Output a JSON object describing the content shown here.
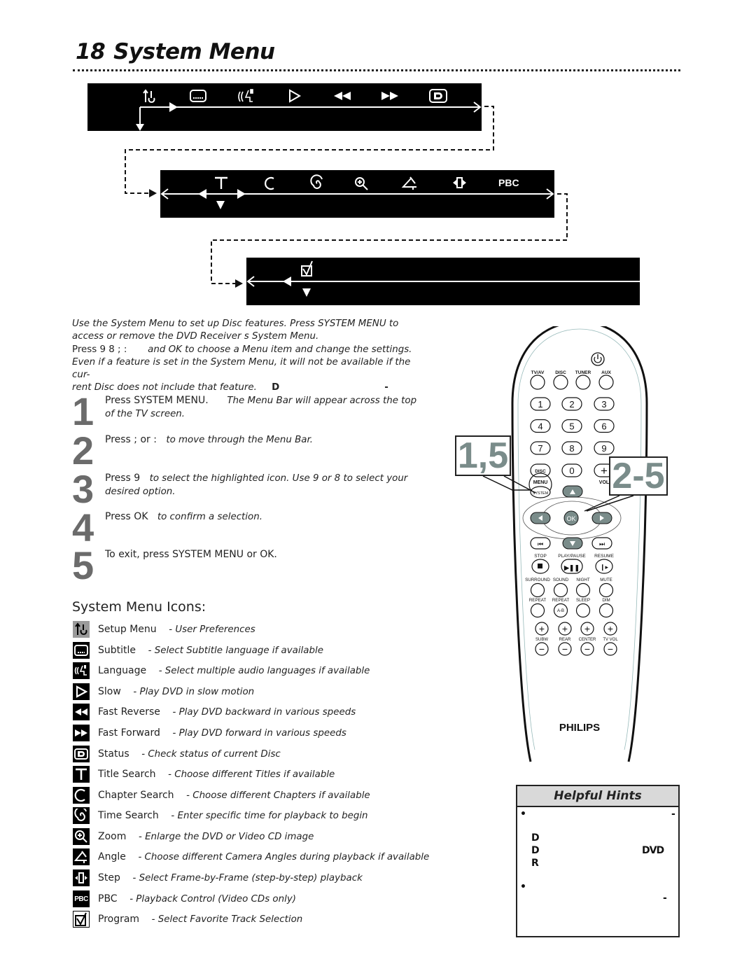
{
  "page": {
    "number": "18",
    "title": "System Menu"
  },
  "menu_bars": [
    {
      "icons": [
        "setup-menu",
        "subtitle",
        "language",
        "slow",
        "fast-reverse",
        "fast-forward",
        "status"
      ]
    },
    {
      "icons": [
        "title-search",
        "chapter-search",
        "time-search",
        "zoom",
        "angle",
        "step",
        "pbc"
      ],
      "pbc_label": "PBC"
    },
    {
      "icons": [
        "program"
      ]
    }
  ],
  "intro": {
    "line1": "Use the System Menu to set up Disc features. Press SYSTEM MENU to",
    "line2": "access or remove the DVD Receiver      s System Menu.",
    "line3_prefix": "Press  9 8 ; :",
    "line3_suffix": "and OK to choose a Menu item and change the settings.",
    "line4": "Even if a feature is set in the System Menu, it will not be available if the cur-",
    "line5": "rent Disc does not include that feature.",
    "line5_bold": "D",
    "line5_dash": "-"
  },
  "steps": [
    {
      "number": "1",
      "action": "Press SYSTEM MENU.",
      "note": "The Menu Bar will appear across the top of the TV screen."
    },
    {
      "number": "2",
      "action": "Press  ;  or  :",
      "note": "to move through the Menu Bar."
    },
    {
      "number": "3",
      "action": "Press  9",
      "note": "to select the highlighted icon. Use    9  or  8    to select your desired option."
    },
    {
      "number": "4",
      "action": "Press OK",
      "note": "to confirm a selection."
    },
    {
      "number": "5",
      "action": "To exit, press SYSTEM MENU or OK.",
      "note": ""
    }
  ],
  "icons_section": {
    "heading": "System Menu Icons:",
    "items": [
      {
        "icon": "setup-menu",
        "name": "Setup Menu",
        "desc": "- User Preferences"
      },
      {
        "icon": "subtitle",
        "name": "Subtitle",
        "desc": "- Select Subtitle language if available"
      },
      {
        "icon": "language",
        "name": "Language",
        "desc": "- Select multiple audio languages if available"
      },
      {
        "icon": "slow",
        "name": "Slow",
        "desc": "- Play DVD in slow motion"
      },
      {
        "icon": "fast-reverse",
        "name": "Fast Reverse",
        "desc": "- Play DVD backward in various speeds"
      },
      {
        "icon": "fast-forward",
        "name": "Fast Forward",
        "desc": "- Play DVD forward in various speeds"
      },
      {
        "icon": "status",
        "name": "Status",
        "desc": "- Check status of current Disc"
      },
      {
        "icon": "title-search",
        "name": "Title Search",
        "desc": "- Choose different Titles if available"
      },
      {
        "icon": "chapter-search",
        "name": "Chapter Search",
        "desc": "- Choose different Chapters if available"
      },
      {
        "icon": "time-search",
        "name": "Time Search",
        "desc": "- Enter specific time for playback to begin"
      },
      {
        "icon": "zoom",
        "name": "Zoom",
        "desc": "- Enlarge the DVD or Video CD image"
      },
      {
        "icon": "angle",
        "name": "Angle",
        "desc": "- Choose different Camera Angles during playback if available"
      },
      {
        "icon": "step",
        "name": "Step",
        "desc": "- Select Frame-by-Frame (step-by-step) playback"
      },
      {
        "icon": "pbc",
        "name": "PBC",
        "desc": "- Playback Control (Video CDs only)",
        "icon_text": "PBC"
      },
      {
        "icon": "program",
        "name": "Program",
        "desc": "- Select Favorite Track Selection"
      }
    ]
  },
  "remote": {
    "brand": "PHILIPS",
    "source_buttons": [
      "TV/AV",
      "DISC",
      "TUNER",
      "AUX"
    ],
    "number_keys": [
      "1",
      "2",
      "3",
      "4",
      "5",
      "6",
      "7",
      "8",
      "9"
    ],
    "zero": "0",
    "disc_menu": "DISC",
    "menu_label": "MENU",
    "system_label": "SYSTEM",
    "vol_label": "VOL",
    "ok_label": "OK",
    "transport_labels": [
      "STOP",
      "PLAY/PAUSE",
      "RESUME"
    ],
    "row_labels_1": [
      "SURROUND",
      "SOUND",
      "NIGHT",
      "MUTE"
    ],
    "row_labels_2": [
      "REPEAT",
      "REPEAT",
      "SLEEP",
      "DIM"
    ],
    "ab_label": "A-B",
    "level_labels": [
      "SUBW",
      "REAR",
      "CENTER",
      "TV VOL"
    ],
    "callout_left": "1,5",
    "callout_right": "2-5",
    "accent_color": "#7a8c8a"
  },
  "hints": {
    "title": "Helpful Hints",
    "bullets": [
      "•",
      "•"
    ],
    "fragments": [
      "-",
      "D",
      "D",
      "DVD",
      "R",
      "-"
    ]
  }
}
